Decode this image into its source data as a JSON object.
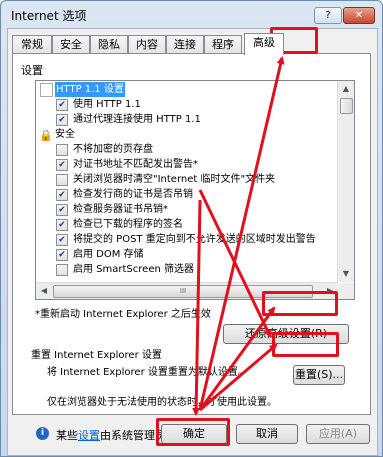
{
  "window": {
    "title": "Internet 选项",
    "help_label": "?",
    "close_label": "✕"
  },
  "tabs": [
    "常规",
    "安全",
    "隐私",
    "内容",
    "连接",
    "程序",
    "高级"
  ],
  "settings": {
    "group_label": "设置",
    "items": [
      {
        "type": "folder",
        "label": "HTTP 1.1 设置",
        "highlighted": true
      },
      {
        "type": "check",
        "checked": true,
        "label": "使用 HTTP 1.1"
      },
      {
        "type": "check",
        "checked": true,
        "label": "通过代理连接使用 HTTP 1.1"
      },
      {
        "type": "lock",
        "label": "安全"
      },
      {
        "type": "check",
        "checked": false,
        "label": "不将加密的页存盘"
      },
      {
        "type": "check",
        "checked": true,
        "label": "对证书地址不匹配发出警告*"
      },
      {
        "type": "check",
        "checked": false,
        "label": "关闭浏览器时清空\"Internet 临时文件\"文件夹"
      },
      {
        "type": "check",
        "checked": true,
        "label": "检查发行商的证书是否吊销"
      },
      {
        "type": "check",
        "checked": true,
        "label": "检查服务器证书吊销*"
      },
      {
        "type": "check",
        "checked": true,
        "label": "检查已下载的程序的签名"
      },
      {
        "type": "check",
        "checked": true,
        "label": "将提交的 POST 重定向到不允许发送的区域时发出警告"
      },
      {
        "type": "check",
        "checked": true,
        "label": "启用 DOM 存储"
      },
      {
        "type": "check",
        "checked": false,
        "label": "启用 SmartScreen 筛选器"
      }
    ],
    "hscroll_grip": "III"
  },
  "restart_note": "*重新启动 Internet Explorer 之后生效",
  "restore_button": "还原高级设置(R)",
  "reset": {
    "title": "重置 Internet Explorer 设置",
    "description": "将 Internet Explorer 设置重置为默认设置。",
    "button": "重置(S)...",
    "warning": "仅在浏览器处于无法使用的状态时，才使用此设置。"
  },
  "info": {
    "prefix": "某些",
    "link": "设置",
    "suffix": "由系统管理员管理。"
  },
  "buttons": {
    "ok": "确定",
    "cancel": "取消",
    "apply": "应用(A)"
  },
  "icons": [
    "help-icon",
    "close-icon",
    "folder-icon",
    "lock-icon",
    "info-icon",
    "checkbox-icon"
  ],
  "colors": {
    "annotation": "#e0101e",
    "link": "#0066cc",
    "selection": "#3399ff"
  }
}
